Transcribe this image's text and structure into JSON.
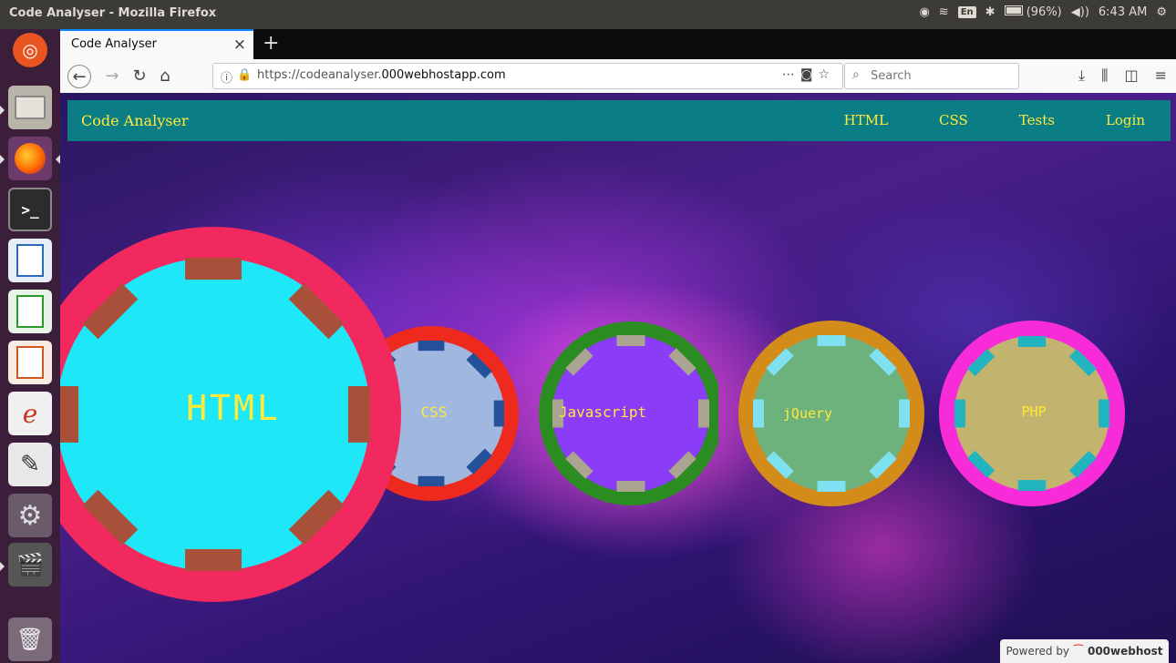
{
  "window": {
    "title": "Code Analyser - Mozilla Firefox"
  },
  "tray": {
    "lang": "En",
    "battery": "(96%)",
    "time": "6:43 AM"
  },
  "browser": {
    "tab_title": "Code Analyser",
    "url_prefix": "https://codeanalyser.",
    "url_domain": "000webhostapp.com",
    "search_placeholder": "Search"
  },
  "site": {
    "brand": "Code Analyser",
    "nav": [
      "HTML",
      "CSS",
      "Tests",
      "Login"
    ]
  },
  "wheels": [
    {
      "label": "HTML",
      "ring": "#f2295f",
      "face": "#1ee8f7",
      "notch": "#a8503a"
    },
    {
      "label": "CSS",
      "ring": "#ee2a1e",
      "face": "#a0b8e0",
      "notch": "#24519a"
    },
    {
      "label": "Javascript",
      "ring": "#2b8c22",
      "face": "#8a3cf6",
      "notch": "#aaa490"
    },
    {
      "label": "jQuery",
      "ring": "#d38c1a",
      "face": "#6db27c",
      "notch": "#7fe0f2"
    },
    {
      "label": "PHP",
      "ring": "#f82bd8",
      "face": "#c2b46e",
      "notch": "#22b4be"
    }
  ],
  "footer": {
    "powered_prefix": "Powered by",
    "powered_brand": "000webhost"
  }
}
